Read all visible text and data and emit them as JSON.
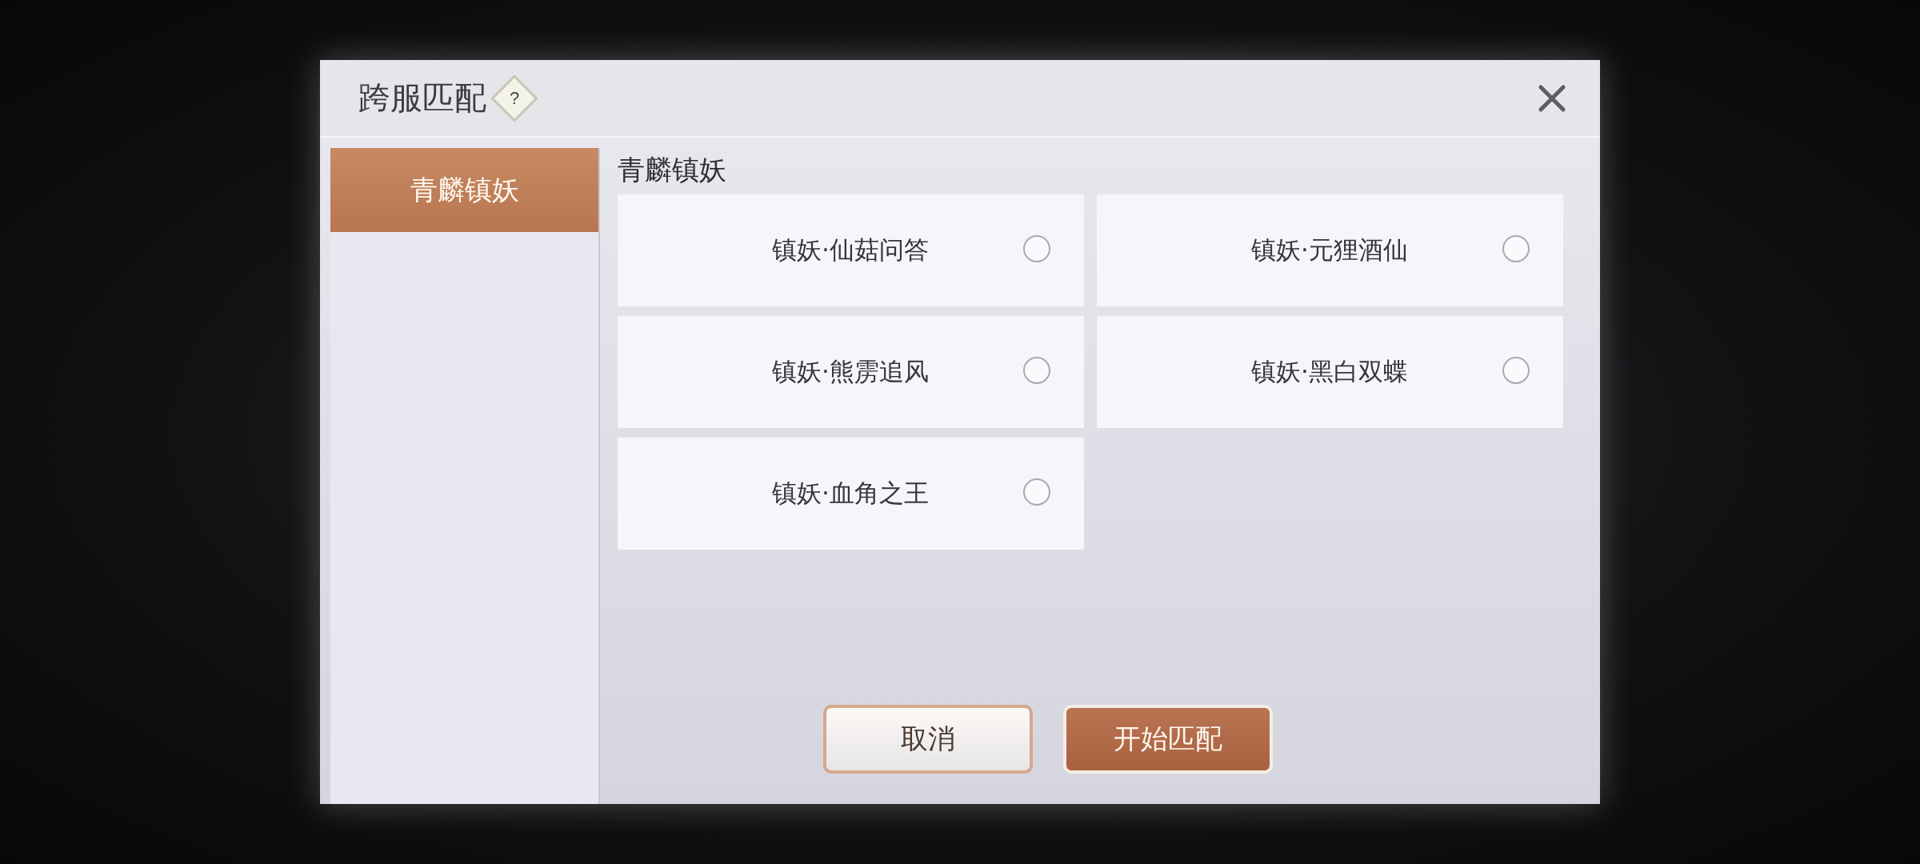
{
  "dialog": {
    "title": "跨服匹配",
    "help_icon": "?"
  },
  "sidebar": {
    "items": [
      {
        "label": "青麟镇妖",
        "selected": true
      }
    ]
  },
  "section_title": "青麟镇妖",
  "options": [
    {
      "label": "镇妖·仙菇问答",
      "selected": false
    },
    {
      "label": "镇妖·元狸酒仙",
      "selected": false
    },
    {
      "label": "镇妖·熊雳追风",
      "selected": false
    },
    {
      "label": "镇妖·黑白双蝶",
      "selected": false
    },
    {
      "label": "镇妖·血角之王",
      "selected": false
    }
  ],
  "buttons": [
    {
      "label": "取消",
      "kind": "secondary"
    },
    {
      "label": "开始匹配",
      "kind": "primary"
    }
  ]
}
